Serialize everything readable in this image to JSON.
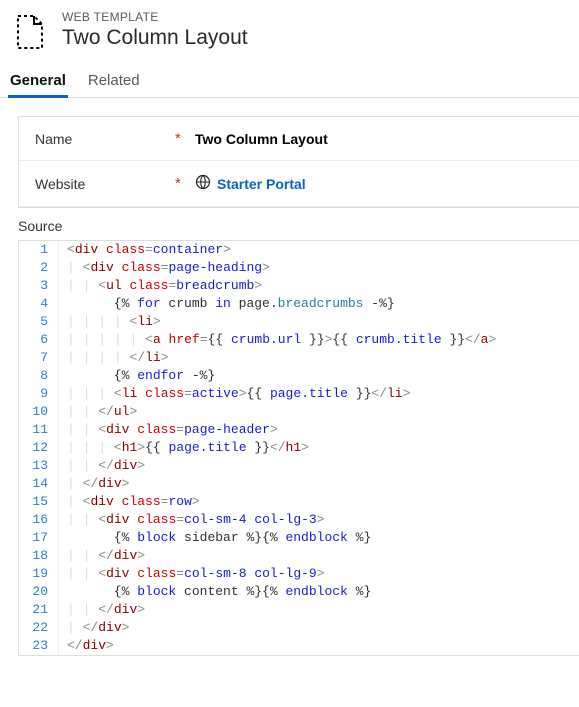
{
  "header": {
    "eyebrow": "WEB TEMPLATE",
    "title": "Two Column Layout"
  },
  "tabs": {
    "general": "General",
    "related": "Related",
    "active": "general"
  },
  "form": {
    "name_label": "Name",
    "name_value": "Two Column Layout",
    "website_label": "Website",
    "website_value": "Starter Portal"
  },
  "source": {
    "label": "Source",
    "lines": [
      [
        {
          "t": "<",
          "c": "d"
        },
        {
          "t": "div ",
          "c": "tg"
        },
        {
          "t": "class",
          "c": "at"
        },
        {
          "t": "=",
          "c": "d"
        },
        {
          "t": "container",
          "c": "av"
        },
        {
          "t": ">",
          "c": "d"
        }
      ],
      [
        {
          "t": "  ",
          "c": ""
        },
        {
          "t": "<",
          "c": "d"
        },
        {
          "t": "div ",
          "c": "tg"
        },
        {
          "t": "class",
          "c": "at"
        },
        {
          "t": "=",
          "c": "d"
        },
        {
          "t": "page-heading",
          "c": "av"
        },
        {
          "t": ">",
          "c": "d"
        }
      ],
      [
        {
          "t": "    ",
          "c": ""
        },
        {
          "t": "<",
          "c": "d"
        },
        {
          "t": "ul ",
          "c": "tg"
        },
        {
          "t": "class",
          "c": "at"
        },
        {
          "t": "=",
          "c": "d"
        },
        {
          "t": "breadcrumb",
          "c": "av"
        },
        {
          "t": ">",
          "c": "d"
        }
      ],
      [
        {
          "t": "      {% ",
          "c": ""
        },
        {
          "t": "for",
          "c": "kw"
        },
        {
          "t": " crumb ",
          "c": ""
        },
        {
          "t": "in",
          "c": "kw"
        },
        {
          "t": " page.",
          "c": ""
        },
        {
          "t": "breadcrumbs",
          "c": "fn"
        },
        {
          "t": " -%}",
          "c": ""
        }
      ],
      [
        {
          "t": "        ",
          "c": ""
        },
        {
          "t": "<",
          "c": "d"
        },
        {
          "t": "li",
          "c": "tg"
        },
        {
          "t": ">",
          "c": "d"
        }
      ],
      [
        {
          "t": "          ",
          "c": ""
        },
        {
          "t": "<",
          "c": "d"
        },
        {
          "t": "a ",
          "c": "tg"
        },
        {
          "t": "href",
          "c": "at"
        },
        {
          "t": "=",
          "c": "d"
        },
        {
          "t": "{{ ",
          "c": ""
        },
        {
          "t": "crumb.url",
          "c": "av"
        },
        {
          "t": " }}",
          "c": ""
        },
        {
          "t": ">",
          "c": "d"
        },
        {
          "t": "{{ ",
          "c": ""
        },
        {
          "t": "crumb.title",
          "c": "av"
        },
        {
          "t": " }}",
          "c": ""
        },
        {
          "t": "</",
          "c": "d"
        },
        {
          "t": "a",
          "c": "tg"
        },
        {
          "t": ">",
          "c": "d"
        }
      ],
      [
        {
          "t": "        ",
          "c": ""
        },
        {
          "t": "</",
          "c": "d"
        },
        {
          "t": "li",
          "c": "tg"
        },
        {
          "t": ">",
          "c": "d"
        }
      ],
      [
        {
          "t": "      {% ",
          "c": ""
        },
        {
          "t": "endfor",
          "c": "kw"
        },
        {
          "t": " -%}",
          "c": ""
        }
      ],
      [
        {
          "t": "      ",
          "c": ""
        },
        {
          "t": "<",
          "c": "d"
        },
        {
          "t": "li ",
          "c": "tg"
        },
        {
          "t": "class",
          "c": "at"
        },
        {
          "t": "=",
          "c": "d"
        },
        {
          "t": "active",
          "c": "tok-active"
        },
        {
          "t": ">",
          "c": "d"
        },
        {
          "t": "{{ ",
          "c": ""
        },
        {
          "t": "page.title",
          "c": "av"
        },
        {
          "t": " }}",
          "c": ""
        },
        {
          "t": "</",
          "c": "d"
        },
        {
          "t": "li",
          "c": "tg"
        },
        {
          "t": ">",
          "c": "d"
        }
      ],
      [
        {
          "t": "    ",
          "c": ""
        },
        {
          "t": "</",
          "c": "d"
        },
        {
          "t": "ul",
          "c": "tg"
        },
        {
          "t": ">",
          "c": "d"
        }
      ],
      [
        {
          "t": "    ",
          "c": ""
        },
        {
          "t": "<",
          "c": "d"
        },
        {
          "t": "div ",
          "c": "tg"
        },
        {
          "t": "class",
          "c": "at"
        },
        {
          "t": "=",
          "c": "d"
        },
        {
          "t": "page-header",
          "c": "av"
        },
        {
          "t": ">",
          "c": "d"
        }
      ],
      [
        {
          "t": "      ",
          "c": ""
        },
        {
          "t": "<",
          "c": "d"
        },
        {
          "t": "h1",
          "c": "tg"
        },
        {
          "t": ">",
          "c": "d"
        },
        {
          "t": "{{ ",
          "c": ""
        },
        {
          "t": "page.title",
          "c": "av"
        },
        {
          "t": " }}",
          "c": ""
        },
        {
          "t": "</",
          "c": "d"
        },
        {
          "t": "h1",
          "c": "tg"
        },
        {
          "t": ">",
          "c": "d"
        }
      ],
      [
        {
          "t": "    ",
          "c": ""
        },
        {
          "t": "</",
          "c": "d"
        },
        {
          "t": "div",
          "c": "tg"
        },
        {
          "t": ">",
          "c": "d"
        }
      ],
      [
        {
          "t": "  ",
          "c": ""
        },
        {
          "t": "</",
          "c": "d"
        },
        {
          "t": "div",
          "c": "tg"
        },
        {
          "t": ">",
          "c": "d"
        }
      ],
      [
        {
          "t": "  ",
          "c": ""
        },
        {
          "t": "<",
          "c": "d"
        },
        {
          "t": "div ",
          "c": "tg"
        },
        {
          "t": "class",
          "c": "at"
        },
        {
          "t": "=",
          "c": "d"
        },
        {
          "t": "row",
          "c": "av"
        },
        {
          "t": ">",
          "c": "d"
        }
      ],
      [
        {
          "t": "    ",
          "c": ""
        },
        {
          "t": "<",
          "c": "d"
        },
        {
          "t": "div ",
          "c": "tg"
        },
        {
          "t": "class",
          "c": "at"
        },
        {
          "t": "=",
          "c": "d"
        },
        {
          "t": "col-sm-4 col-lg-3",
          "c": "av"
        },
        {
          "t": ">",
          "c": "d"
        }
      ],
      [
        {
          "t": "      {% ",
          "c": ""
        },
        {
          "t": "block",
          "c": "kw"
        },
        {
          "t": " sidebar %}{% ",
          "c": ""
        },
        {
          "t": "endblock",
          "c": "kw"
        },
        {
          "t": " %}",
          "c": ""
        }
      ],
      [
        {
          "t": "    ",
          "c": ""
        },
        {
          "t": "</",
          "c": "d"
        },
        {
          "t": "div",
          "c": "tg"
        },
        {
          "t": ">",
          "c": "d"
        }
      ],
      [
        {
          "t": "    ",
          "c": ""
        },
        {
          "t": "<",
          "c": "d"
        },
        {
          "t": "div ",
          "c": "tg"
        },
        {
          "t": "class",
          "c": "at"
        },
        {
          "t": "=",
          "c": "d"
        },
        {
          "t": "col-sm-8 col-lg-9",
          "c": "av"
        },
        {
          "t": ">",
          "c": "d"
        }
      ],
      [
        {
          "t": "      {% ",
          "c": ""
        },
        {
          "t": "block",
          "c": "kw"
        },
        {
          "t": " content %}{% ",
          "c": ""
        },
        {
          "t": "endblock",
          "c": "kw"
        },
        {
          "t": " %}",
          "c": ""
        }
      ],
      [
        {
          "t": "    ",
          "c": ""
        },
        {
          "t": "</",
          "c": "d"
        },
        {
          "t": "div",
          "c": "tg"
        },
        {
          "t": ">",
          "c": "d"
        }
      ],
      [
        {
          "t": "  ",
          "c": ""
        },
        {
          "t": "</",
          "c": "d"
        },
        {
          "t": "div",
          "c": "tg"
        },
        {
          "t": ">",
          "c": "d"
        }
      ],
      [
        {
          "t": "",
          "c": ""
        },
        {
          "t": "</",
          "c": "d"
        },
        {
          "t": "div",
          "c": "tg"
        },
        {
          "t": ">",
          "c": "d"
        }
      ]
    ]
  }
}
